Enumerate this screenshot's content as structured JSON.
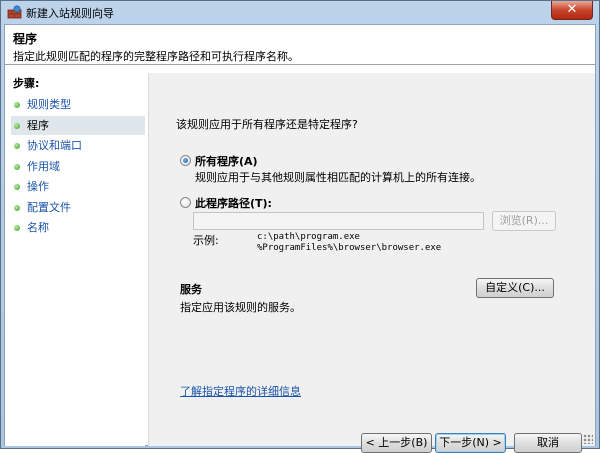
{
  "window": {
    "title": "新建入站规则向导",
    "close_label": "✕",
    "icon": "firewall-icon"
  },
  "header": {
    "title": "程序",
    "description": "指定此规则匹配的程序的完整程序路径和可执行程序名称。"
  },
  "steps": {
    "title": "步骤:",
    "items": [
      {
        "label": "规则类型",
        "active": false
      },
      {
        "label": "程序",
        "active": true
      },
      {
        "label": "协议和端口",
        "active": false
      },
      {
        "label": "作用域",
        "active": false
      },
      {
        "label": "操作",
        "active": false
      },
      {
        "label": "配置文件",
        "active": false
      },
      {
        "label": "名称",
        "active": false
      }
    ]
  },
  "main": {
    "question": "该规则应用于所有程序还是特定程序?",
    "all_programs": {
      "label": "所有程序(A)",
      "description": "规则应用于与其他规则属性相匹配的计算机上的所有连接。",
      "checked": true
    },
    "this_program": {
      "label": "此程序路径(T):",
      "checked": false,
      "path_value": "",
      "browse_label": "浏览(R)...",
      "example_label": "示例:",
      "example_lines": [
        "c:\\path\\program.exe",
        "%ProgramFiles%\\browser\\browser.exe"
      ]
    },
    "services": {
      "title": "服务",
      "description": "指定应用该规则的服务。",
      "customize_label": "自定义(C)..."
    },
    "learn_more_link": "了解指定程序的详细信息"
  },
  "footer": {
    "back_label": "< 上一步(B)",
    "next_label": "下一步(N) >",
    "cancel_label": "取消"
  },
  "colors": {
    "link": "#1a53a8",
    "title_bar": "#bcd3ea",
    "content_bg": "#f0f0f0"
  }
}
